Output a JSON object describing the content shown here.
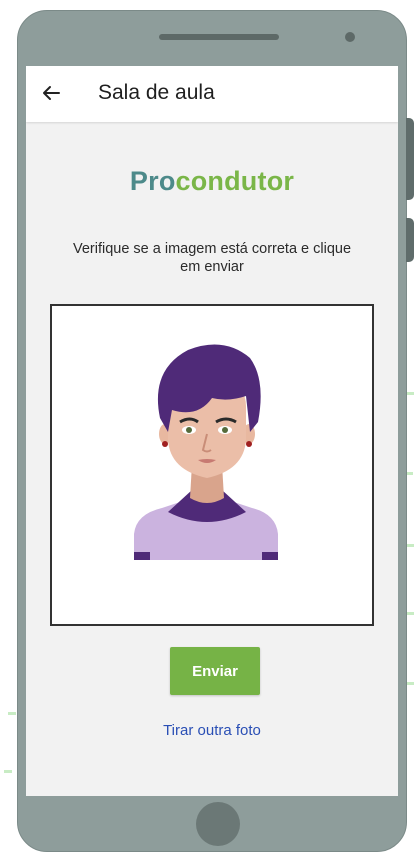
{
  "header": {
    "title": "Sala de aula"
  },
  "brand": {
    "part1": "Pro",
    "part2": "condutor"
  },
  "instructions": "Verifique se a imagem está correta e clique em enviar",
  "actions": {
    "send_label": "Enviar",
    "retake_label": "Tirar outra foto"
  },
  "colors": {
    "accent_green": "#76b346",
    "link_blue": "#2a4fb5",
    "brand_teal": "#4d8a8a",
    "hair_purple": "#4f2a78"
  }
}
